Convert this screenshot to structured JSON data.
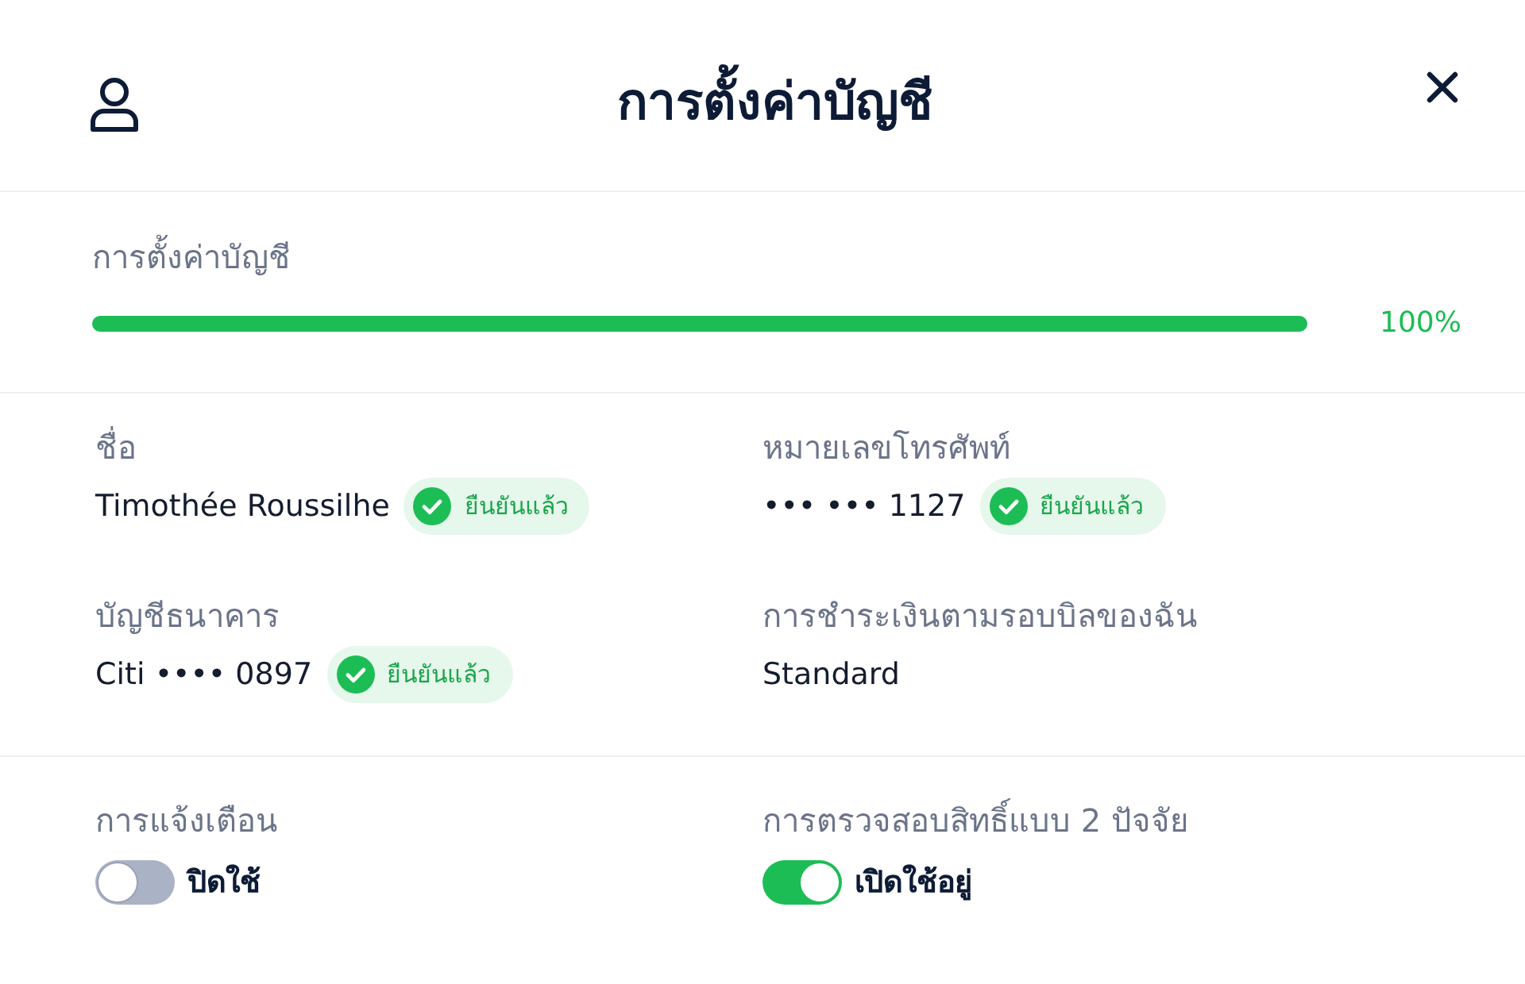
{
  "header": {
    "title": "การตั้งค่าบัญชี"
  },
  "progress": {
    "label": "การตั้งค่าบัญชี",
    "level": 1,
    "reading": "100%"
  },
  "fields": [
    {
      "label": "ชื่อ",
      "value": "Timothée Roussilhe",
      "verified": true,
      "badge": "ยืนยันแล้ว"
    },
    {
      "label": "หมายเลขโทรศัพท์",
      "value": "••• ••• 1127",
      "verified": true,
      "badge": "ยืนยันแล้ว"
    },
    {
      "label": "บัญชีธนาคาร",
      "value": "Citi •••• 0897",
      "verified": true,
      "badge": "ยืนยันแล้ว"
    },
    {
      "label": "การชำระเงินตามรอบบิลของฉัน",
      "value": "Standard",
      "verified": false
    }
  ],
  "toggles": [
    {
      "label": "การแจ้งเตือน",
      "on": false,
      "state_text": "ปิดใช้"
    },
    {
      "label": "การตรวจสอบสิทธิ์แบบ 2 ปัจจัย",
      "on": true,
      "state_text": "เปิดใช้อยู่"
    }
  ]
}
